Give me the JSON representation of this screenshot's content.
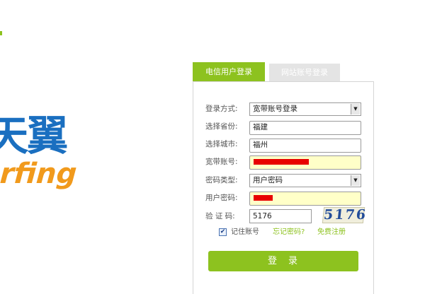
{
  "brand": {
    "logo_cn": "天翼",
    "logo_en": "rfing"
  },
  "tabs": [
    {
      "label": "电信用户登录",
      "active": true
    },
    {
      "label": "网站账号登录",
      "active": false
    }
  ],
  "form": {
    "login_method": {
      "label": "登录方式:",
      "value": "宽带账号登录"
    },
    "province": {
      "label": "选择省份:",
      "value": "福建"
    },
    "city": {
      "label": "选择城市:",
      "value": "福州"
    },
    "account": {
      "label": "宽带账号:",
      "value_redacted": true
    },
    "password_type": {
      "label": "密码类型:",
      "value": "用户密码"
    },
    "password": {
      "label": "用户密码:",
      "value_redacted": true
    },
    "captcha": {
      "label": "验 证 码:",
      "value": "5176",
      "image_text": "5176"
    },
    "remember": {
      "label": "记住账号",
      "checked": true
    },
    "forgot_link": "忘记密码?",
    "register_link": "免费注册",
    "submit_label": "登录"
  },
  "colors": {
    "accent": "#8dc21f",
    "logo_blue": "#1a6fc0",
    "logo_orange": "#f19a1c",
    "redaction": "#e80000",
    "field_highlight": "#ffffc8"
  }
}
